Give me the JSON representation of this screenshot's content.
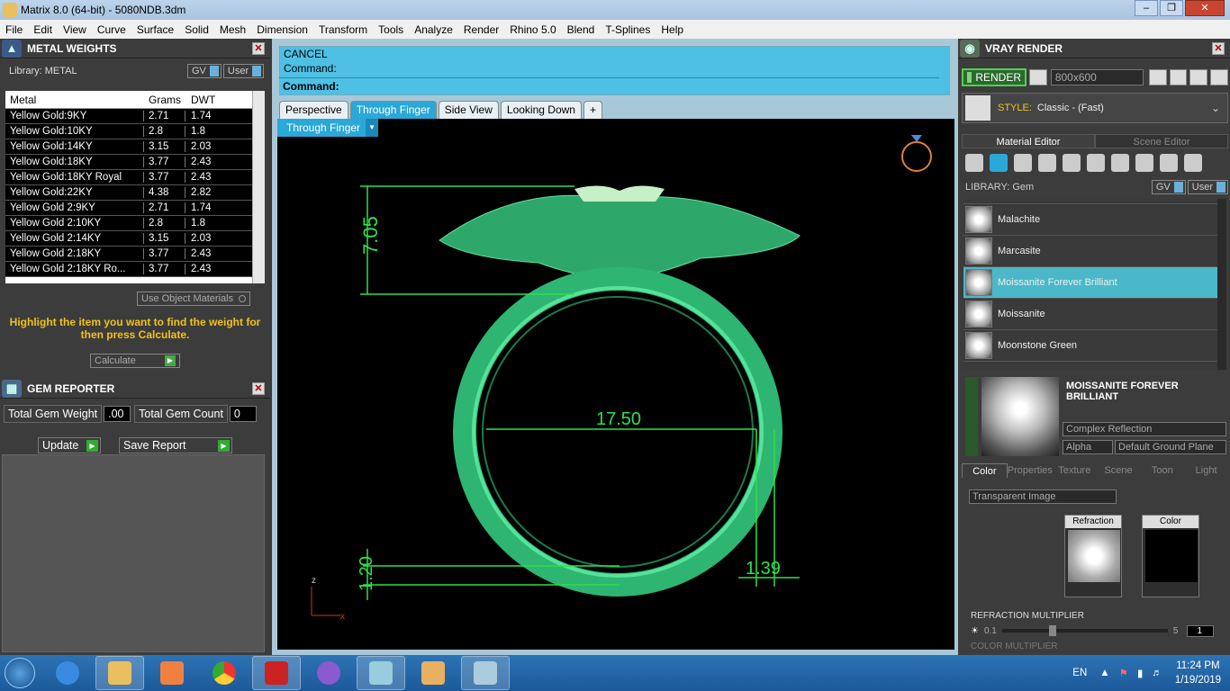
{
  "window": {
    "title": "Matrix 8.0 (64-bit) - 5080NDB.3dm"
  },
  "menu": [
    "File",
    "Edit",
    "View",
    "Curve",
    "Surface",
    "Solid",
    "Mesh",
    "Dimension",
    "Transform",
    "Tools",
    "Analyze",
    "Render",
    "Rhino 5.0",
    "Blend",
    "T-Splines",
    "Help"
  ],
  "metal_weights": {
    "title": "METAL WEIGHTS",
    "library_label": "Library: METAL",
    "gv_label": "GV",
    "user_label": "User",
    "columns": [
      "Metal",
      "Grams",
      "DWT"
    ],
    "rows": [
      [
        "Yellow Gold:9KY",
        "2.71",
        "1.74"
      ],
      [
        "Yellow Gold:10KY",
        "2.8",
        "1.8"
      ],
      [
        "Yellow Gold:14KY",
        "3.15",
        "2.03"
      ],
      [
        "Yellow Gold:18KY",
        "3.77",
        "2.43"
      ],
      [
        "Yellow Gold:18KY Royal",
        "3.77",
        "2.43"
      ],
      [
        "Yellow Gold:22KY",
        "4.38",
        "2.82"
      ],
      [
        "Yellow Gold 2:9KY",
        "2.71",
        "1.74"
      ],
      [
        "Yellow Gold 2:10KY",
        "2.8",
        "1.8"
      ],
      [
        "Yellow Gold 2:14KY",
        "3.15",
        "2.03"
      ],
      [
        "Yellow Gold 2:18KY",
        "3.77",
        "2.43"
      ],
      [
        "Yellow Gold 2:18KY Ro...",
        "3.77",
        "2.43"
      ]
    ],
    "use_object_materials": "Use Object Materials",
    "hint": "Highlight the item you want to find the weight for then press Calculate.",
    "calculate": "Calculate"
  },
  "gem_reporter": {
    "title": "GEM REPORTER",
    "total_weight_label": "Total Gem Weight",
    "total_weight_value": ".00",
    "total_count_label": "Total Gem Count",
    "total_count_value": "0",
    "update": "Update",
    "save_report": "Save Report"
  },
  "command": {
    "line1": "CANCEL",
    "line2": "Command:",
    "prompt": "Command:"
  },
  "viewport_tabs": [
    "Perspective",
    "Through Finger",
    "Side View",
    "Looking Down"
  ],
  "add_tab_icon": "+",
  "viewport": {
    "active_view": "Through Finger",
    "dimensions": [
      "7.05",
      "17.50",
      "1.20",
      "1.39"
    ],
    "axis_z": "z",
    "axis_x": "x"
  },
  "vray": {
    "title": "VRAY RENDER",
    "render": "RENDER",
    "resolution": "800x600",
    "style_label": "STYLE:",
    "style_value": "Classic - (Fast)",
    "editor_tabs": [
      "Material Editor",
      "Scene Editor"
    ],
    "library_label": "LIBRARY: Gem",
    "gv_label": "GV",
    "user_label": "User",
    "gems": [
      "Malachite",
      "Marcasite",
      "Moissanite Forever Brilliant",
      "Moissanite",
      "Moonstone Green"
    ],
    "selected_gem": "Moissanite Forever Brilliant",
    "material_title": "MOISSANITE FOREVER BRILLIANT",
    "reflection": "Complex Reflection",
    "alpha": "Alpha",
    "ground": "Default Ground Plane",
    "mat_tabs": [
      "Color",
      "Properties",
      "Texture",
      "Scene",
      "Toon",
      "Light"
    ],
    "color_mode": "Transparent Image",
    "refraction_box": "Refraction",
    "color_box": "Color",
    "refraction_multiplier": "REFRACTION MULTIPLIER",
    "slider_min": "0.1",
    "slider_max": "5",
    "slider_value": "1",
    "color_multiplier": "COLOR MULTIPLIER"
  },
  "taskbar": {
    "lang": "EN",
    "time": "11:24 PM",
    "date": "1/19/2019"
  },
  "colors": {
    "accent": "#2aa8d8",
    "command_bg": "#4ec0e4",
    "ring": "#3ecf8a",
    "dim_lines": "#2fe04a"
  }
}
